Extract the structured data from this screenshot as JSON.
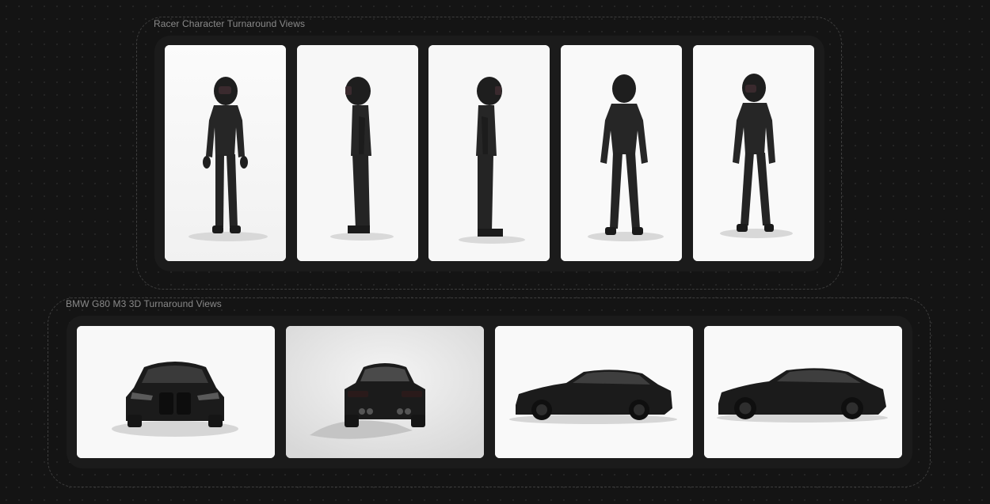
{
  "groups": [
    {
      "label": "Racer Character Turnaround Views",
      "items": [
        {
          "subject": "racer",
          "view": "front"
        },
        {
          "subject": "racer",
          "view": "side-left"
        },
        {
          "subject": "racer",
          "view": "side-right"
        },
        {
          "subject": "racer",
          "view": "back"
        },
        {
          "subject": "racer",
          "view": "three-quarter"
        }
      ]
    },
    {
      "label": "BMW G80 M3 3D Turnaround Views",
      "items": [
        {
          "subject": "car",
          "view": "front"
        },
        {
          "subject": "car",
          "view": "rear"
        },
        {
          "subject": "car",
          "view": "side-left"
        },
        {
          "subject": "car",
          "view": "side-right"
        }
      ]
    }
  ],
  "colors": {
    "canvas": "#141414",
    "tray": "#1b1b1b",
    "label": "#8a8a8a",
    "card": "#ffffff",
    "subject": "#1c1c1c"
  }
}
